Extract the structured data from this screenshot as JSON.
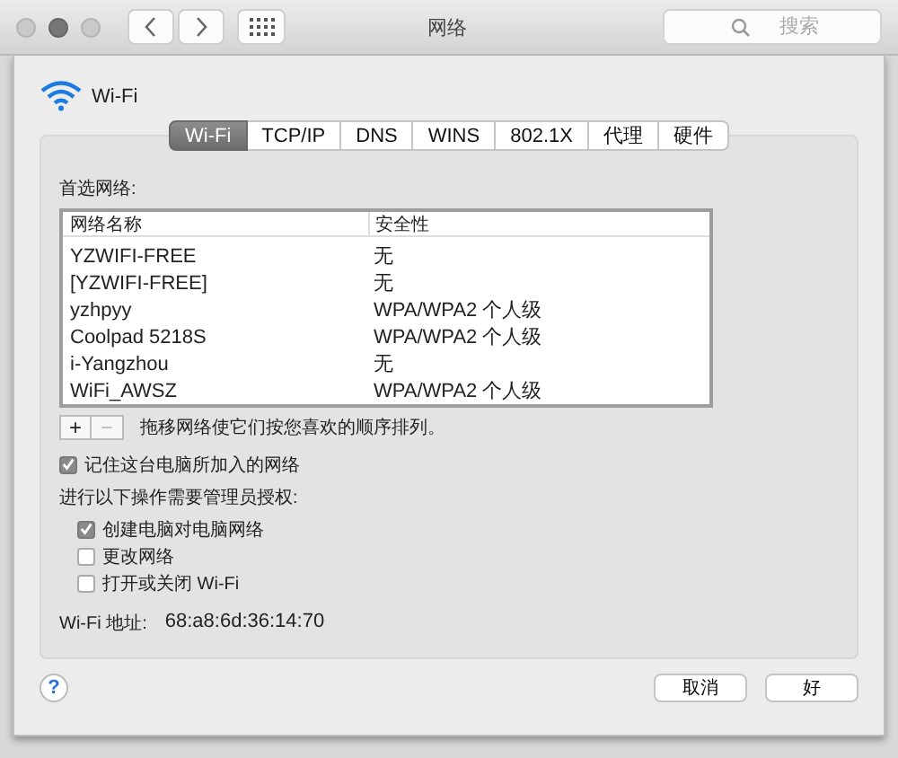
{
  "window": {
    "title": "网络",
    "search": {
      "placeholder": "搜索"
    }
  },
  "header": {
    "label": "Wi-Fi"
  },
  "tabs": [
    {
      "label": "Wi-Fi",
      "selected": true
    },
    {
      "label": "TCP/IP",
      "selected": false
    },
    {
      "label": "DNS",
      "selected": false
    },
    {
      "label": "WINS",
      "selected": false
    },
    {
      "label": "802.1X",
      "selected": false
    },
    {
      "label": "代理",
      "selected": false
    },
    {
      "label": "硬件",
      "selected": false
    }
  ],
  "preferred_networks": {
    "label": "首选网络:",
    "columns": [
      "网络名称",
      "安全性"
    ],
    "rows": [
      {
        "name": "YZWIFI-FREE",
        "security": "无"
      },
      {
        "name": "[YZWIFI-FREE]",
        "security": "无"
      },
      {
        "name": "yzhpyy",
        "security": "WPA/WPA2 个人级"
      },
      {
        "name": "Coolpad 5218S",
        "security": "WPA/WPA2 个人级"
      },
      {
        "name": "i-Yangzhou",
        "security": "无"
      },
      {
        "name": "WiFi_AWSZ",
        "security": "WPA/WPA2 个人级"
      }
    ],
    "add_button": {
      "label": "+",
      "disabled": false
    },
    "remove_button": {
      "label": "−",
      "disabled": true
    },
    "hint": "拖移网络使它们按您喜欢的顺序排列。"
  },
  "remember": {
    "label": "记住这台电脑所加入的网络",
    "checked": true
  },
  "admin": {
    "label": "进行以下操作需要管理员授权:",
    "options": [
      {
        "label": "创建电脑对电脑网络",
        "checked": true
      },
      {
        "label": "更改网络",
        "checked": false
      },
      {
        "label": "打开或关闭 Wi-Fi",
        "checked": false
      }
    ]
  },
  "address": {
    "label": "Wi-Fi 地址:",
    "value": "68:a8:6d:36:14:70"
  },
  "help_button": {
    "label": "?"
  },
  "buttons": [
    {
      "label": "取消"
    },
    {
      "label": "好"
    }
  ]
}
